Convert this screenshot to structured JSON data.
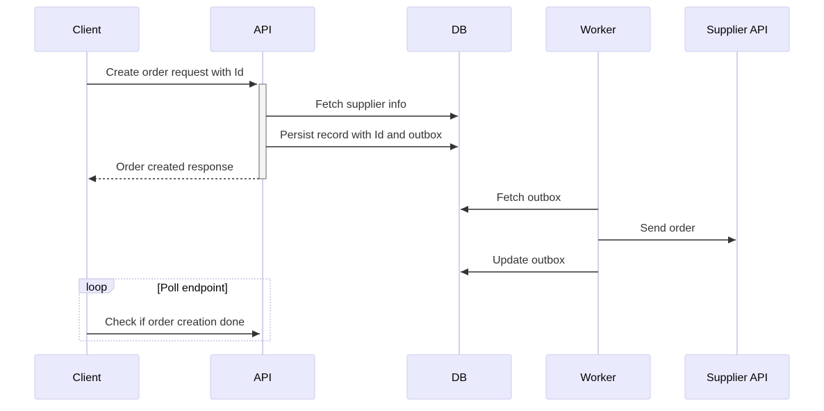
{
  "participants": [
    "Client",
    "API",
    "DB",
    "Worker",
    "Supplier API"
  ],
  "messages": [
    {
      "from": "Client",
      "to": "API",
      "text": "Create order request with Id",
      "style": "solid"
    },
    {
      "from": "API",
      "to": "DB",
      "text": "Fetch supplier info",
      "style": "solid"
    },
    {
      "from": "API",
      "to": "DB",
      "text": "Persist record with Id and outbox",
      "style": "solid"
    },
    {
      "from": "API",
      "to": "Client",
      "text": "Order created response",
      "style": "dashed"
    },
    {
      "from": "Worker",
      "to": "DB",
      "text": "Fetch outbox",
      "style": "solid"
    },
    {
      "from": "Worker",
      "to": "Supplier API",
      "text": "Send order",
      "style": "solid"
    },
    {
      "from": "Worker",
      "to": "DB",
      "text": "Update outbox",
      "style": "solid"
    },
    {
      "from": "Client",
      "to": "API",
      "text": "Check if order creation done",
      "style": "solid"
    }
  ],
  "loop": {
    "label": "loop",
    "condition": "[Poll endpoint]"
  },
  "colors": {
    "actor_fill": "#eaeafd",
    "actor_stroke": "#ccccf0",
    "lifeline": "#d4d0ee",
    "arrow": "#333333",
    "activation_fill": "#f4f4f4",
    "activation_stroke": "#666666"
  }
}
